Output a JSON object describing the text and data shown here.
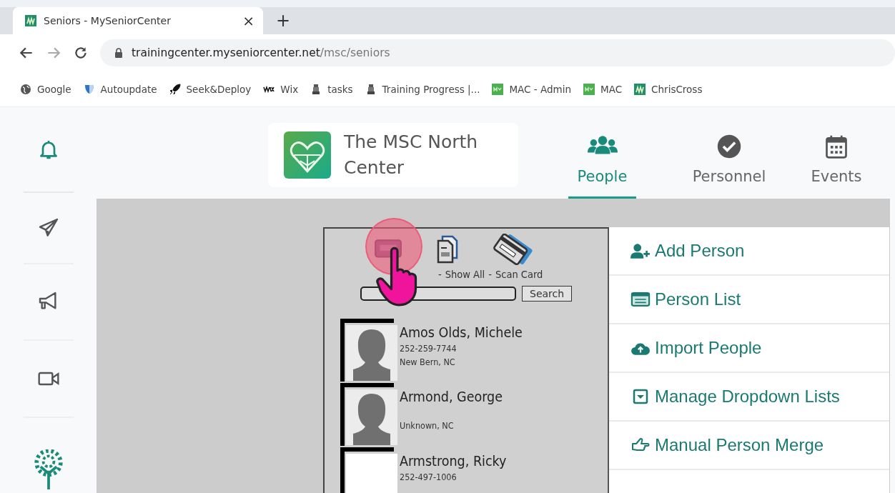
{
  "browser": {
    "tab": {
      "title": "Seniors - MySeniorCenter",
      "close": "×",
      "new_tab": "+"
    },
    "address": {
      "host": "trainingcenter.myseniorcenter.net",
      "path": "/msc/seniors"
    },
    "bookmarks": [
      {
        "label": "Google",
        "kind": "globe"
      },
      {
        "label": "Autoupdate",
        "kind": "shield"
      },
      {
        "label": "Seek&Deploy",
        "kind": "rocket"
      },
      {
        "label": "Wix",
        "kind": "wix"
      },
      {
        "label": "tasks",
        "kind": "figure"
      },
      {
        "label": "Training Progress |...",
        "kind": "figure"
      },
      {
        "label": "MAC - Admin",
        "kind": "my"
      },
      {
        "label": "MAC",
        "kind": "my"
      },
      {
        "label": "ChrisCross",
        "kind": "m"
      }
    ]
  },
  "sidebar": {
    "items": [
      {
        "kind": "bell"
      },
      {
        "kind": "plane"
      },
      {
        "kind": "megaphone"
      },
      {
        "kind": "video"
      },
      {
        "kind": "tree"
      }
    ]
  },
  "header": {
    "center_name": "The MSC North Center",
    "nav": [
      {
        "label": "People",
        "kind": "people",
        "selected": true
      },
      {
        "label": "Personnel",
        "kind": "check",
        "selected": false
      },
      {
        "label": "Events",
        "kind": "calendar",
        "selected": false
      }
    ]
  },
  "people_panel": {
    "toolbar": [
      {
        "label": "Show All",
        "kind": "docs"
      },
      {
        "label": "Scan Card",
        "kind": "card"
      }
    ],
    "separator": "-",
    "search_button": "Search",
    "people": [
      {
        "name": "Amos Olds, Michele",
        "phone": "252-259-7744",
        "city": "New Bern, NC",
        "kind": "silhouette"
      },
      {
        "name": "Armond, George",
        "city": "Unknown, NC",
        "kind": "silhouette"
      },
      {
        "name": "Armstrong, Ricky",
        "phone": "252-497-1006",
        "kind": "blank"
      }
    ]
  },
  "menu": [
    {
      "label": "Add Person",
      "kind": "user-plus"
    },
    {
      "label": "Person List",
      "kind": "list"
    },
    {
      "label": "Import People",
      "kind": "cloud-upload"
    },
    {
      "label": "Manage Dropdown Lists",
      "kind": "dropdown"
    },
    {
      "label": "Manual Person Merge",
      "kind": "hand"
    }
  ]
}
